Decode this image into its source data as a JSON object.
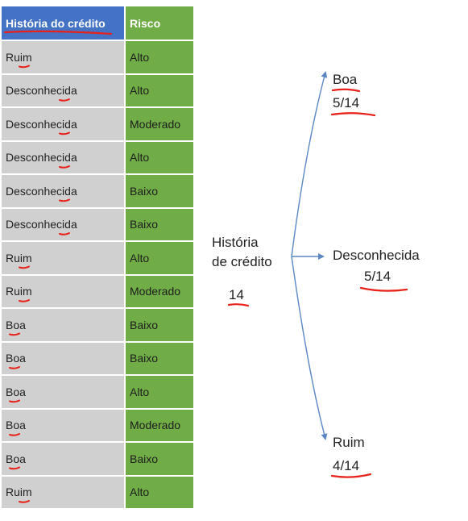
{
  "table": {
    "headers": [
      "História do crédito",
      "Risco"
    ],
    "rows": [
      [
        "Ruim",
        "Alto"
      ],
      [
        "Desconhecida",
        "Alto"
      ],
      [
        "Desconhecida",
        "Moderado"
      ],
      [
        "Desconhecida",
        "Alto"
      ],
      [
        "Desconhecida",
        "Baixo"
      ],
      [
        "Desconhecida",
        "Baixo"
      ],
      [
        "Ruim",
        "Alto"
      ],
      [
        "Ruim",
        "Moderado"
      ],
      [
        "Boa",
        "Baixo"
      ],
      [
        "Boa",
        "Baixo"
      ],
      [
        "Boa",
        "Alto"
      ],
      [
        "Boa",
        "Moderado"
      ],
      [
        "Boa",
        "Baixo"
      ],
      [
        "Ruim",
        "Alto"
      ]
    ]
  },
  "tree": {
    "root": {
      "label_line1": "História",
      "label_line2": "de crédito",
      "count": "14"
    },
    "branches": [
      {
        "label": "Boa",
        "fraction": "5/14"
      },
      {
        "label": "Desconhecida",
        "fraction": "5/14"
      },
      {
        "label": "Ruim",
        "fraction": "4/14"
      }
    ]
  },
  "colors": {
    "header_blue": "#4472c4",
    "risk_green": "#70ad47",
    "row_gray": "#d0d0d0",
    "arrow_blue": "#5b87c5",
    "annotation_red": "#e8211a"
  }
}
